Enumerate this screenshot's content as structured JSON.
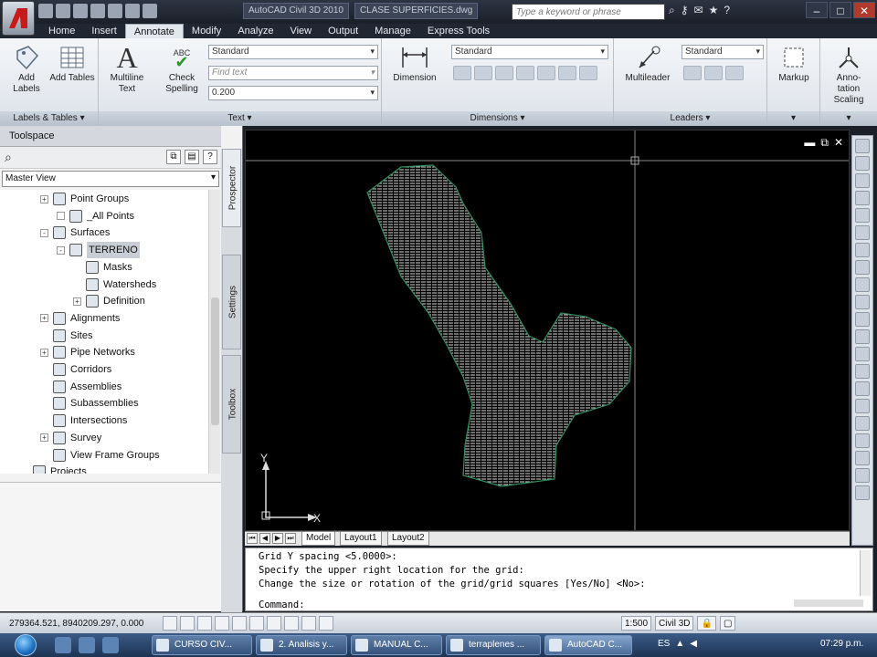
{
  "window": {
    "app_title": "AutoCAD Civil 3D 2010",
    "document_title": "CLASE SUPERFICIES.dwg",
    "search_placeholder": "Type a keyword or phrase"
  },
  "ribbon": {
    "tabs": [
      "Home",
      "Insert",
      "Annotate",
      "Modify",
      "Analyze",
      "View",
      "Output",
      "Manage",
      "Express Tools"
    ],
    "active_tab": "Annotate",
    "panels": {
      "labels_tables": {
        "title": "Labels & Tables",
        "add_labels": "Add Labels",
        "add_tables": "Add Tables"
      },
      "text": {
        "title": "Text",
        "multiline_text": "Multiline Text",
        "check_spelling": "Check Spelling",
        "abc_glyph": "ABC",
        "style_value": "Standard",
        "find_placeholder": "Find text",
        "height_value": "0.200"
      },
      "dimensions": {
        "title": "Dimensions",
        "dimension": "Dimension",
        "style_value": "Standard"
      },
      "leaders": {
        "title": "Leaders",
        "multileader": "Multileader",
        "style_value": "Standard"
      },
      "markup": {
        "label": "Markup"
      },
      "annotation_scaling": {
        "label": "Anno-tation Scaling"
      }
    }
  },
  "toolspace": {
    "title": "Toolspace",
    "view_selector": "Master View",
    "side_tabs": [
      "Prospector",
      "Settings",
      "Toolbox"
    ],
    "tree": [
      {
        "label": "Point Groups",
        "level": 2,
        "expander": "+"
      },
      {
        "label": "_All Points",
        "level": 3,
        "expander": "•"
      },
      {
        "label": "Surfaces",
        "level": 2,
        "expander": "-"
      },
      {
        "label": "TERRENO",
        "level": 3,
        "expander": "-",
        "selected": true
      },
      {
        "label": "Masks",
        "level": 4,
        "expander": ""
      },
      {
        "label": "Watersheds",
        "level": 4,
        "expander": ""
      },
      {
        "label": "Definition",
        "level": 4,
        "expander": "+"
      },
      {
        "label": "Alignments",
        "level": 2,
        "expander": "+"
      },
      {
        "label": "Sites",
        "level": 2,
        "expander": ""
      },
      {
        "label": "Pipe Networks",
        "level": 2,
        "expander": "+"
      },
      {
        "label": "Corridors",
        "level": 2,
        "expander": ""
      },
      {
        "label": "Assemblies",
        "level": 2,
        "expander": ""
      },
      {
        "label": "Subassemblies",
        "level": 2,
        "expander": ""
      },
      {
        "label": "Intersections",
        "level": 2,
        "expander": ""
      },
      {
        "label": "Survey",
        "level": 2,
        "expander": "+"
      },
      {
        "label": "View Frame Groups",
        "level": 2,
        "expander": ""
      },
      {
        "label": "Projects",
        "level": 1,
        "expander": ""
      }
    ]
  },
  "viewport": {
    "ucs_y": "Y",
    "ucs_x": "X",
    "layout_tabs": [
      "Model",
      "Layout1",
      "Layout2"
    ],
    "active_layout": "Model",
    "background": "#000000",
    "surface_color": "#d9d9d9",
    "border_color": "#2f8f5f"
  },
  "command_line": {
    "lines": [
      "Grid Y spacing <5.0000>:",
      "Specify the upper right location for the grid:",
      "Change the size or rotation of the grid/grid squares [Yes/No] <No>:"
    ],
    "prompt": "Command:"
  },
  "statusbar": {
    "coordinates": "279364.521, 8940209.297, 0.000",
    "scale": "1:500",
    "workspace": "Civil 3D"
  },
  "taskbar": {
    "tasks": [
      "CURSO CIV...",
      "2. Analisis y...",
      "MANUAL C...",
      "terraplenes ...",
      "AutoCAD C..."
    ],
    "active_task": "AutoCAD C...",
    "language": "ES",
    "clock": "07:29 p.m."
  }
}
